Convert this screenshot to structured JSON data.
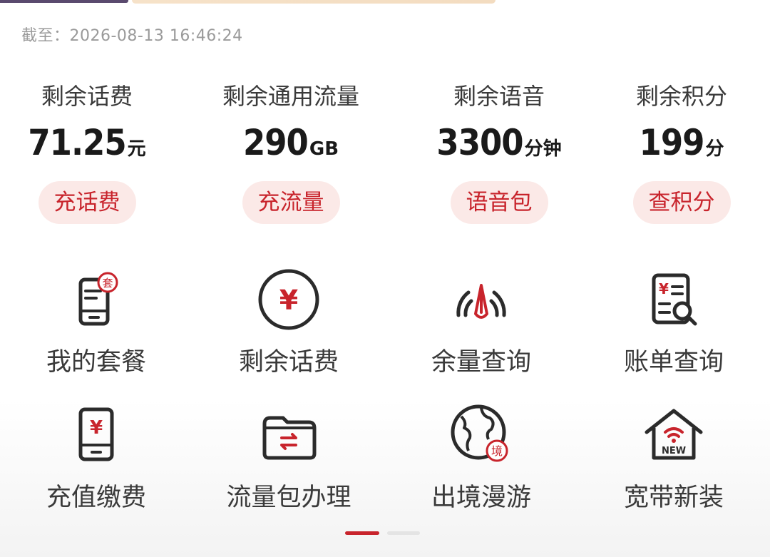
{
  "timestamp": "截至：2026-08-13 16:46:24",
  "stats": [
    {
      "label": "剩余话费",
      "value": "71.25",
      "unit": "元",
      "action": "充话费"
    },
    {
      "label": "剩余通用流量",
      "value": "290",
      "unit": "GB",
      "action": "充流量"
    },
    {
      "label": "剩余语音",
      "value": "3300",
      "unit": "分钟",
      "action": "语音包"
    },
    {
      "label": "剩余积分",
      "value": "199",
      "unit": "分",
      "action": "查积分"
    }
  ],
  "services": [
    {
      "label": "我的套餐",
      "icon": "plan-phone-icon",
      "badge": "套"
    },
    {
      "label": "剩余话费",
      "icon": "yuan-circle-icon"
    },
    {
      "label": "余量查询",
      "icon": "gauge-icon"
    },
    {
      "label": "账单查询",
      "icon": "bill-search-icon"
    },
    {
      "label": "充值缴费",
      "icon": "recharge-phone-icon"
    },
    {
      "label": "流量包办理",
      "icon": "data-folder-icon"
    },
    {
      "label": "出境漫游",
      "icon": "globe-roaming-icon",
      "badge": "境"
    },
    {
      "label": "宽带新装",
      "icon": "broadband-house-icon",
      "badge": "NEW"
    }
  ],
  "pager": {
    "active_index": 0,
    "count": 2
  },
  "colors": {
    "accent": "#c8242c",
    "pill_bg": "#fbe9e7",
    "icon_dark": "#2b2b2b"
  }
}
